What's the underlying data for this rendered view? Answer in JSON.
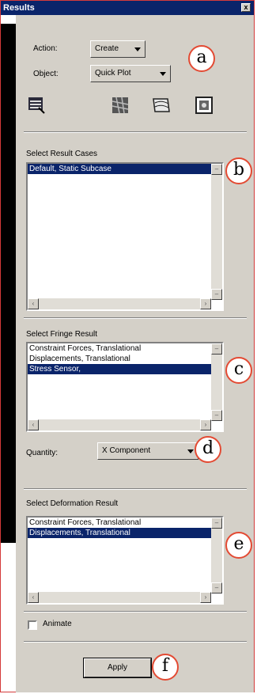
{
  "window": {
    "title": "Results",
    "close_label": "x"
  },
  "action": {
    "label": "Action:",
    "value": "Create"
  },
  "object": {
    "label": "Object:",
    "value": "Quick Plot"
  },
  "toolbar": {
    "icons": [
      "select-results-icon",
      "fringe-plot-icon",
      "deformation-plot-icon",
      "display-attributes-icon"
    ]
  },
  "result_cases": {
    "label": "Select Result Cases",
    "items": [
      "Default, Static Subcase"
    ],
    "selected_index": 0
  },
  "fringe_result": {
    "label": "Select Fringe Result",
    "items": [
      "Constraint Forces, Translational",
      "Displacements, Translational",
      "Stress Sensor,"
    ],
    "selected_index": 2
  },
  "quantity": {
    "label": "Quantity:",
    "value": "X Component"
  },
  "deformation_result": {
    "label": "Select Deformation Result",
    "items": [
      "Constraint Forces, Translational",
      "Displacements, Translational"
    ],
    "selected_index": 1
  },
  "animate": {
    "label": "Animate",
    "checked": false
  },
  "apply": {
    "label": "Apply"
  },
  "callouts": {
    "a": "a",
    "b": "b",
    "c": "c",
    "d": "d",
    "e": "e",
    "f": "f"
  },
  "colors": {
    "title_bar": "#0a246a",
    "panel": "#d4d0c8",
    "selection": "#0a246a",
    "callout_border": "#e34a33",
    "frame": "#d43a3a"
  }
}
